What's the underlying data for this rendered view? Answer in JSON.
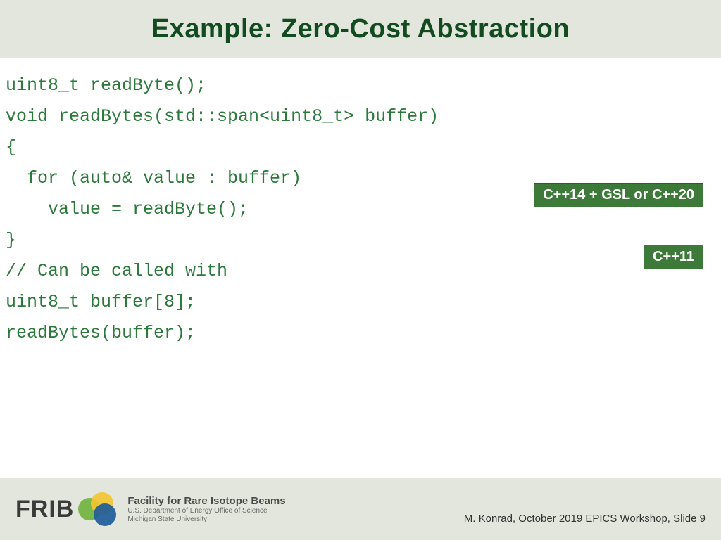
{
  "header": {
    "title": "Example: Zero-Cost Abstraction"
  },
  "code": {
    "l1": "uint8_t readByte();",
    "l2": "",
    "l3": "void readBytes(std::span<uint8_t> buffer)",
    "l4": "{",
    "l5": "  for (auto& value : buffer)",
    "l6": "    value = readByte();",
    "l7": "}",
    "l8": "",
    "l9": "// Can be called with",
    "l10": "uint8_t buffer[8];",
    "l11": "readBytes(buffer);"
  },
  "badges": {
    "span_version": "C++14 + GSL or C++20",
    "rangefor_version": "C++11"
  },
  "footer": {
    "logo_text": "FRIB",
    "facility": "Facility for Rare Isotope Beams",
    "sub1": "U.S. Department of Energy Office of Science",
    "sub2": "Michigan State University",
    "attribution": "M. Konrad, October 2019 EPICS Workshop, Slide 9"
  }
}
